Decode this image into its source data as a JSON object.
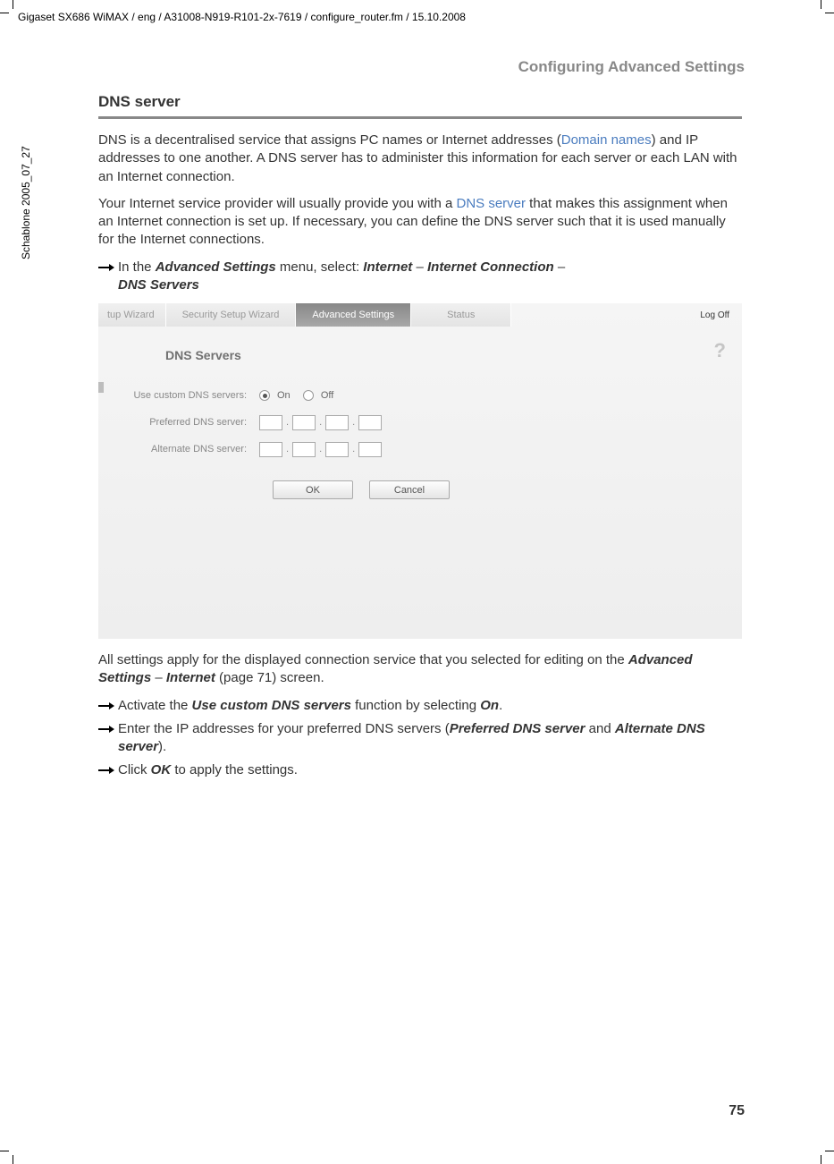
{
  "header_path": "Gigaset SX686 WiMAX / eng / A31008-N919-R101-2x-7619 / configure_router.fm / 15.10.2008",
  "sidebar": "Schablone 2005_07_27",
  "breadcrumb": "Configuring Advanced Settings",
  "section_title": "DNS server",
  "para1_part1": "DNS is a decentralised service that assigns PC names or Internet addresses (",
  "para1_link1": "Domain names",
  "para1_part2": ") and IP addresses to one another. A DNS server has to administer this information for each server or each LAN with an Internet connection.",
  "para2_part1": "Your Internet service provider will usually provide you with a ",
  "para2_link1": "DNS server",
  "para2_part2": " that makes this assignment when an Internet connection is set up. If necessary, you can define the DNS server such that it is used manually for the Internet connections.",
  "bullet1_pre": "In the ",
  "bullet1_b1": "Advanced Settings",
  "bullet1_mid1": " menu, select: ",
  "bullet1_b2": "Internet",
  "bullet1_dash1": " – ",
  "bullet1_b3": "Internet Connection",
  "bullet1_dash2": " – ",
  "bullet1_b4": "DNS Servers",
  "ui": {
    "tabs": {
      "wizard": "tup Wizard",
      "security": "Security Setup Wizard",
      "advanced": "Advanced Settings",
      "status": "Status"
    },
    "logoff": "Log Off",
    "panel_title": "DNS Servers",
    "help": "?",
    "labels": {
      "custom": "Use custom DNS servers:",
      "preferred": "Preferred DNS server:",
      "alternate": "Alternate DNS server:"
    },
    "on": "On",
    "off": "Off",
    "buttons": {
      "ok": "OK",
      "cancel": "Cancel"
    }
  },
  "para3_part1": "All settings apply for the displayed connection service that you selected for editing on the ",
  "para3_b1": "Advanced Settings",
  "para3_dash": " – ",
  "para3_b2": "Internet",
  "para3_part2": " (page 71) screen.",
  "bullet2_pre": "Activate the ",
  "bullet2_b1": "Use custom DNS servers",
  "bullet2_mid": " function by selecting ",
  "bullet2_b2": "On",
  "bullet2_end": ".",
  "bullet3_pre": "Enter the IP addresses for your preferred DNS servers (",
  "bullet3_b1": "Preferred DNS server",
  "bullet3_mid": " and ",
  "bullet3_b2": "Alternate DNS server",
  "bullet3_end": ").",
  "bullet4_pre": "Click ",
  "bullet4_b1": "OK",
  "bullet4_end": " to apply the settings.",
  "page_number": "75"
}
